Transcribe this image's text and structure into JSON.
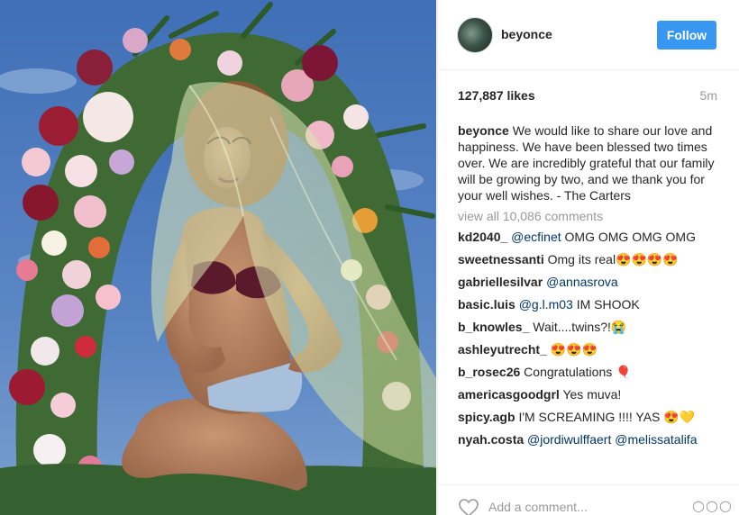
{
  "post": {
    "username": "beyonce",
    "follow_label": "Follow",
    "likes": "127,887 likes",
    "time_ago": "5m",
    "caption_user": "beyonce",
    "caption_text": "We would like to share our love and happiness. We have been blessed two times over. We are incredibly grateful that our family will be growing by two, and we thank you for your well wishes. - The Carters",
    "view_all": "view all 10,086 comments"
  },
  "comments": [
    {
      "user": "kd2040_",
      "mention": "@ecfinet",
      "text": " OMG OMG OMG OMG"
    },
    {
      "user": "sweetnessanti",
      "mention": "",
      "text": " Omg its real😍😍😍😍"
    },
    {
      "user": "gabriellesilvar",
      "mention": "@annasrova",
      "text": ""
    },
    {
      "user": "basic.luis",
      "mention": "@g.l.m03",
      "text": " IM SHOOK"
    },
    {
      "user": "b_knowles_",
      "mention": "",
      "text": " Wait....twins?!😭"
    },
    {
      "user": "ashleyutrecht_",
      "mention": "",
      "text": " 😍😍😍"
    },
    {
      "user": "b_rosec26",
      "mention": "",
      "text": " Congratulations 🎈"
    },
    {
      "user": "americasgoodgrl",
      "mention": "",
      "text": " Yes muva!"
    },
    {
      "user": "spicy.agb",
      "mention": "",
      "text": " I'M SCREAMING !!!! YAS 😍💛"
    },
    {
      "user": "nyah.costa",
      "mention": "@jordiwulffaert @melissatalifa",
      "text": ""
    }
  ],
  "add_comment": {
    "placeholder": "Add a comment...",
    "more_glyph": "○○○"
  },
  "colors": {
    "follow_bg": "#3897f0",
    "sky": "#4a76b8",
    "veil": "#d6e2a6"
  },
  "icons": {
    "like": "heart-icon",
    "options": "more-options-icon"
  }
}
